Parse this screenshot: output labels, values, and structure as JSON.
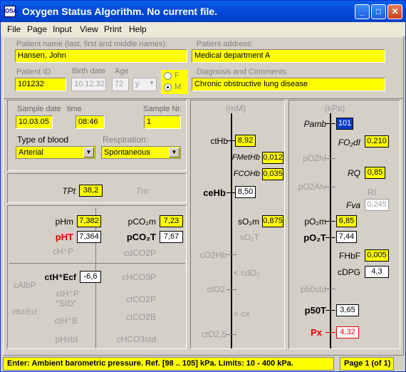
{
  "window": {
    "title": "Oxygen Status Algorithm.  No current file.",
    "icon_text": "OSA"
  },
  "menu": [
    "File",
    "Page",
    "Input",
    "View",
    "Print",
    "Help"
  ],
  "patient": {
    "name_label": "Patient name (last,  first and middle names):",
    "name_value": "Hansen, John",
    "address_label": "Patient address:",
    "address_value": "Medical department A",
    "id_label": "Patient ID",
    "id_value": "101232",
    "birth_label": "Birth date",
    "birth_value": "10.12.32",
    "age_label": "Age",
    "age_value": "72",
    "age_unit": "y",
    "sex_f": "F",
    "sex_m": "M",
    "diag_label": "Diagnosis and Comments",
    "diag_value": "Chronic obstructive lung disease"
  },
  "sample": {
    "date_label": "Sample date",
    "date_value": "10.03.05",
    "time_label": "time",
    "time_value": "08:46",
    "nr_label": "Sample Nr.",
    "nr_value": "1",
    "blood_label": "Type of blood",
    "blood_value": "Arterial",
    "resp_label": "Respiration:",
    "resp_value": "Spontaneous"
  },
  "temp": {
    "tpt_label": "TPt",
    "tpt_value": "38,2",
    "tm_label": "Tm"
  },
  "acid": {
    "phm_label": "pHm",
    "phm_value": "7,382",
    "pco2m_label": "pCO₂m",
    "pco2m_value": "7,23",
    "pht_label": "pHT",
    "pht_value": "7,364",
    "pco2t_label": "pCO₂T",
    "pco2t_value": "7,67",
    "chp_label": "cH⁺P",
    "cdco2p_label": "cdCO2P",
    "cherf_label": "ctH⁺Ecf",
    "cherf_value": "-6,6",
    "chco3p_label": "cHCO3P",
    "calbp_label": "cAlbP",
    "cthp_label": "ctH⁺P",
    "sid_label": "\"SID\"",
    "ibv_label": "I/B/I/Ecf",
    "cthb_label": "ctH⁺B",
    "ctco2p_label": "ctCO2P",
    "ctco2b_label": "ctCO2B",
    "phstd_label": "pHstd",
    "chco3std_label": "cHCO3std"
  },
  "mid": {
    "unit": "(mM)",
    "cthb_label": "ctHb",
    "cthb_value": "8,92",
    "fmethb_label": "FMetHb",
    "fmethb_value": "0,012",
    "fcohb_label": "FCOHb",
    "fcohb_value": "0,035",
    "ceHb_label": "ceHb",
    "ceHb_value": "8,50",
    "so2m_label": "sO₂m",
    "so2m_value": "0,875",
    "so2t_label": "sO₂T",
    "co2hb_label": "cO2Hb",
    "cdo2_label": "< cdO₂",
    "cto2_label": "ctO2",
    "cx_label": "< cx",
    "cto25_label": "ctO2,5"
  },
  "right": {
    "unit": "(kPa)",
    "pamb_label": "Pamb",
    "pamb_value": "101",
    "fo2di_label": "FO₂dI",
    "fo2di_value": "0,210",
    "po2i_label": "pO2hI",
    "rq_label": "RQ",
    "rq_value": "0,85",
    "po2alv_label": "pO2Alv",
    "ri_label": "RI",
    "fva_label": "Fva",
    "fva_value": "0,245",
    "po2m_label": "pO₂m",
    "po2m_value": "6,85",
    "po2t_label": "pO₂T",
    "po2t_value": "7,44",
    "fhbf_label": "FHbF",
    "fhbf_value": "0,005",
    "cdpg_label": "cDPG",
    "cdpg_value": "4,3",
    "p50std_label": "p50std",
    "p50t_label": "p50T",
    "p50t_value": "3,65",
    "px_label": "Px",
    "px_value": "4,32"
  },
  "status": {
    "message": "Enter:  Ambient barometric pressure.  Ref. [98 .. 105] kPa.  Limits: 10 - 400 kPa.",
    "page": "Page 1 (of 1)"
  }
}
